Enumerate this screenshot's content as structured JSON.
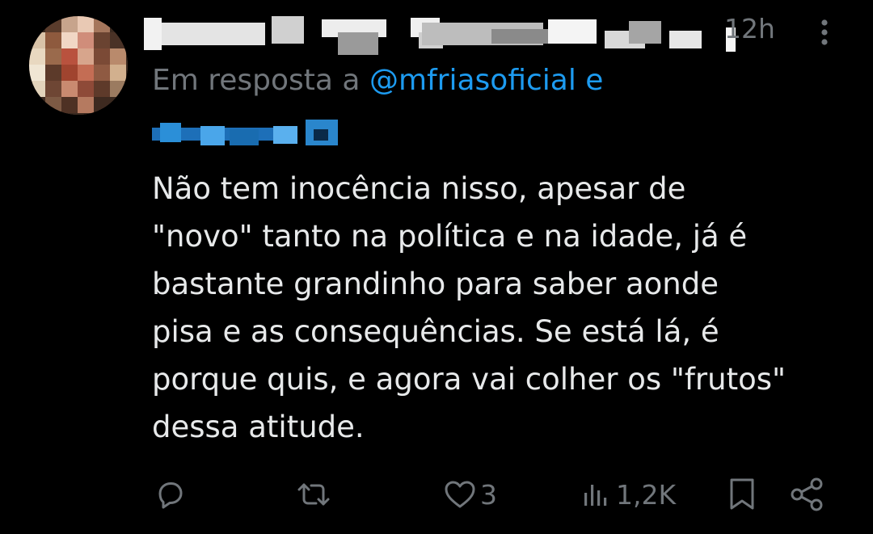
{
  "tweet": {
    "time": "12h",
    "reply_prefix": "Em resposta a",
    "reply_mention": "@mfriasoficial e",
    "body": "Não tem inocência nisso, apesar de\n\"novo\" tanto na política e na idade, já é\nbastante grandinho para  saber aonde\npisa e as consequências. Se está lá, é\nporque quis, e agora vai colher os \"frutos\"\ndessa atitude.",
    "likes": "3",
    "views": "1,2K"
  },
  "colors": {
    "background": "#000000",
    "text": "#e7e9ea",
    "muted": "#71767b",
    "accent": "#1d9bf0"
  },
  "icons": [
    "more-icon",
    "reply-icon",
    "retweet-icon",
    "like-icon",
    "views-icon",
    "bookmark-icon",
    "share-icon"
  ]
}
